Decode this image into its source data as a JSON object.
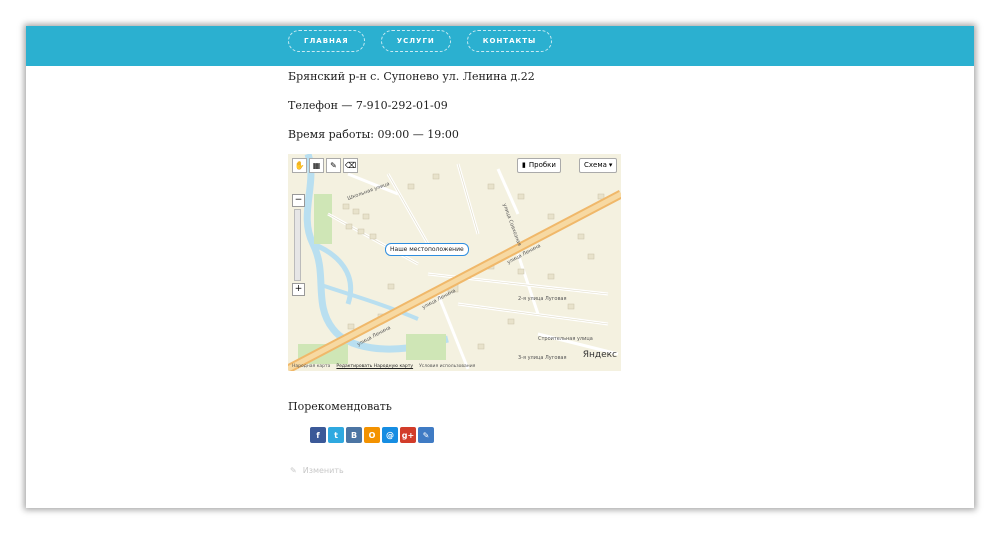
{
  "nav": {
    "items": [
      {
        "label": "Главная"
      },
      {
        "label": "Услуги"
      },
      {
        "label": "Контакты"
      }
    ]
  },
  "contact": {
    "address": "Брянский р-н с. Супонево ул. Ленина д.22",
    "phone": "Телефон — 7-910-292-01-09",
    "hours": "Время работы:  09:00 — 19:00"
  },
  "map": {
    "traffic_label": "Пробки",
    "scheme_label": "Схема",
    "marker_label": "Наше местоположение",
    "brand": "Яндекс",
    "footer_text": "Народная карта",
    "footer_edit": "Редактировать Народную карту",
    "footer_terms": "Условия использования",
    "street_labels": [
      "улица Ленина",
      "улица Ленина",
      "улица Ленина",
      "2-я улица Луговая",
      "Школьная улица",
      "улица Совхозная",
      "Строительная улица",
      "3-я улица Луговая"
    ]
  },
  "share": {
    "label": "Порекомендовать",
    "buttons": [
      {
        "icon": "facebook-icon",
        "glyph": "f",
        "color": "#3b5998"
      },
      {
        "icon": "twitter-icon",
        "glyph": "t",
        "color": "#2fa9e0"
      },
      {
        "icon": "vkontakte-icon",
        "glyph": "В",
        "color": "#4c75a3"
      },
      {
        "icon": "odnoklassniki-icon",
        "glyph": "О",
        "color": "#f39200"
      },
      {
        "icon": "mailru-icon",
        "glyph": "@",
        "color": "#168de2"
      },
      {
        "icon": "googleplus-icon",
        "glyph": "g+",
        "color": "#d23c2a"
      },
      {
        "icon": "livejournal-icon",
        "glyph": "✎",
        "color": "#3f7bc4"
      }
    ]
  },
  "edit": {
    "label": "Изменить"
  }
}
